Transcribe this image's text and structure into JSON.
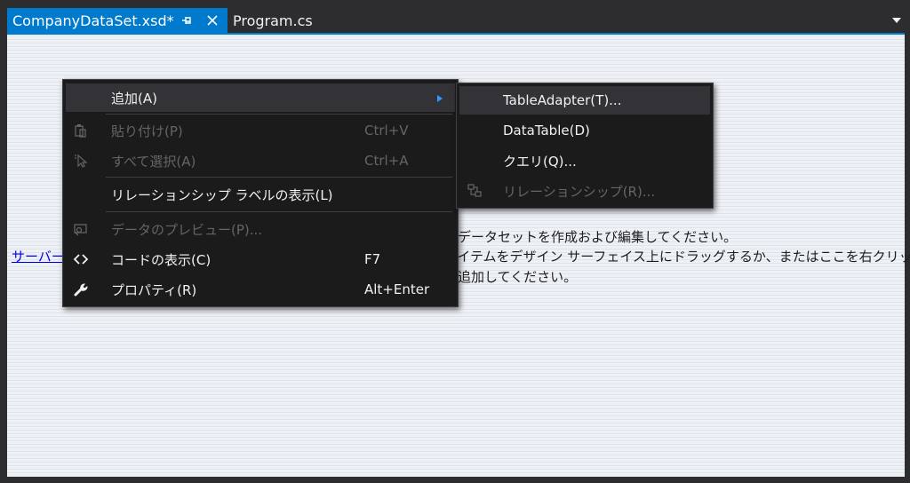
{
  "tabs": [
    {
      "label": "CompanyDataSet.xsd*",
      "active": true
    },
    {
      "label": "Program.cs",
      "active": false
    }
  ],
  "colors": {
    "accent": "#007acc",
    "menu_bg": "#1b1b1c",
    "menu_highlight": "#333337",
    "disabled_text": "#656565"
  },
  "designer": {
    "link_text": "サーバー",
    "hint_lines": [
      "とデータセットを作成および編集してください。",
      "アイテムをデザイン  サーフェイス上にドラッグするか、またはここを右クリック",
      "を追加してください。"
    ]
  },
  "context_menu": {
    "items": [
      {
        "label": "追加(A)",
        "shortcut": "",
        "icon": "none",
        "enabled": true,
        "highlighted": true,
        "submenu": true
      },
      {
        "label": "貼り付け(P)",
        "shortcut": "Ctrl+V",
        "icon": "paste-icon",
        "enabled": false
      },
      {
        "label": "すべて選択(A)",
        "shortcut": "Ctrl+A",
        "icon": "select-all-icon",
        "enabled": false
      },
      {
        "label": "リレーションシップ ラベルの表示(L)",
        "shortcut": "",
        "icon": "none",
        "enabled": true
      },
      {
        "label": "データのプレビュー(P)...",
        "shortcut": "",
        "icon": "preview-data-icon",
        "enabled": false
      },
      {
        "label": "コードの表示(C)",
        "shortcut": "F7",
        "icon": "code-icon",
        "enabled": true
      },
      {
        "label": "プロパティ(R)",
        "shortcut": "Alt+Enter",
        "icon": "wrench-icon",
        "enabled": true
      }
    ]
  },
  "submenu": {
    "items": [
      {
        "label": "TableAdapter(T)...",
        "icon": "none",
        "enabled": true,
        "highlighted": true
      },
      {
        "label": "DataTable(D)",
        "icon": "none",
        "enabled": true
      },
      {
        "label": "クエリ(Q)...",
        "icon": "none",
        "enabled": true
      },
      {
        "label": "リレーションシップ(R)...",
        "icon": "relation-icon",
        "enabled": false
      }
    ]
  }
}
